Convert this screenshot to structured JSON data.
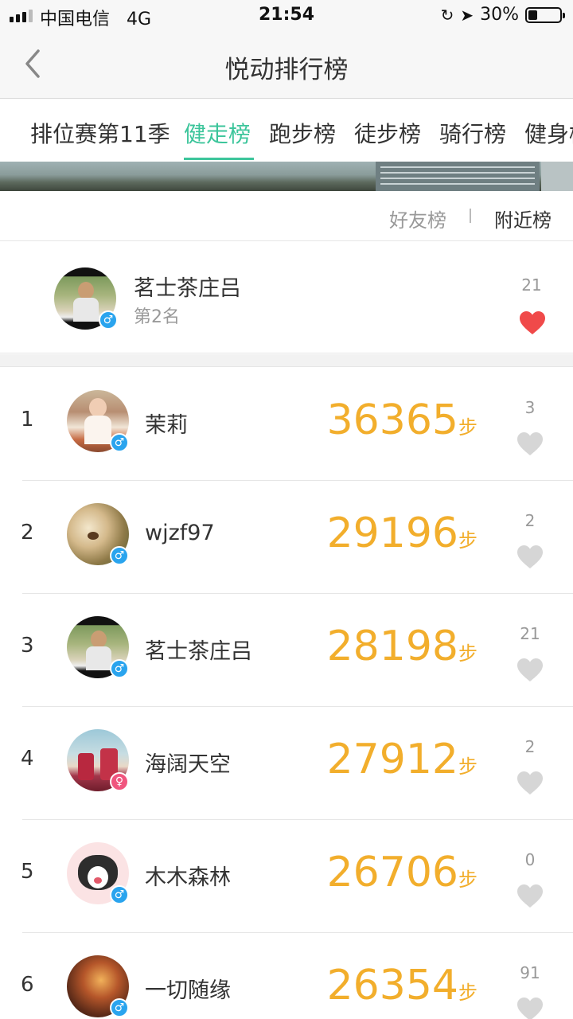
{
  "status_bar": {
    "carrier": "中国电信",
    "network": "4G",
    "time": "21:54",
    "battery_text": "30%",
    "battery_level": 0.3
  },
  "nav": {
    "title": "悦动排行榜"
  },
  "tabs": [
    {
      "label": "排位赛第11季",
      "active": false
    },
    {
      "label": "健走榜",
      "active": true
    },
    {
      "label": "跑步榜",
      "active": false
    },
    {
      "label": "徒步榜",
      "active": false
    },
    {
      "label": "骑行榜",
      "active": false
    },
    {
      "label": "健身榜",
      "active": false
    }
  ],
  "subtabs": {
    "friends": "好友榜",
    "separator": "I",
    "nearby": "附近榜"
  },
  "me": {
    "name": "茗士茶庄吕",
    "rank_text": "第2名",
    "likes": "21",
    "liked": true,
    "gender": "male"
  },
  "list": [
    {
      "rank": "1",
      "name": "茉莉",
      "steps": "36365",
      "unit": "步",
      "likes": "3",
      "gender": "male"
    },
    {
      "rank": "2",
      "name": "wjzf97",
      "steps": "29196",
      "unit": "步",
      "likes": "2",
      "gender": "male"
    },
    {
      "rank": "3",
      "name": "茗士茶庄吕",
      "steps": "28198",
      "unit": "步",
      "likes": "21",
      "gender": "male"
    },
    {
      "rank": "4",
      "name": "海阔天空",
      "steps": "27912",
      "unit": "步",
      "likes": "2",
      "gender": "female"
    },
    {
      "rank": "5",
      "name": "木木森林",
      "steps": "26706",
      "unit": "步",
      "likes": "0",
      "gender": "male"
    },
    {
      "rank": "6",
      "name": "一切随缘",
      "steps": "26354",
      "unit": "步",
      "likes": "91",
      "gender": "male"
    }
  ],
  "colors": {
    "accent": "#3cc59b",
    "steps": "#f2ae2c",
    "heart_liked": "#f04a4a",
    "heart_unliked": "#d6d6d6",
    "male": "#2aa4ee",
    "female": "#f0557e"
  },
  "icons": {
    "back": "chevron-left-icon",
    "heart": "heart-icon",
    "male": "male-symbol-icon",
    "female": "female-symbol-icon"
  }
}
